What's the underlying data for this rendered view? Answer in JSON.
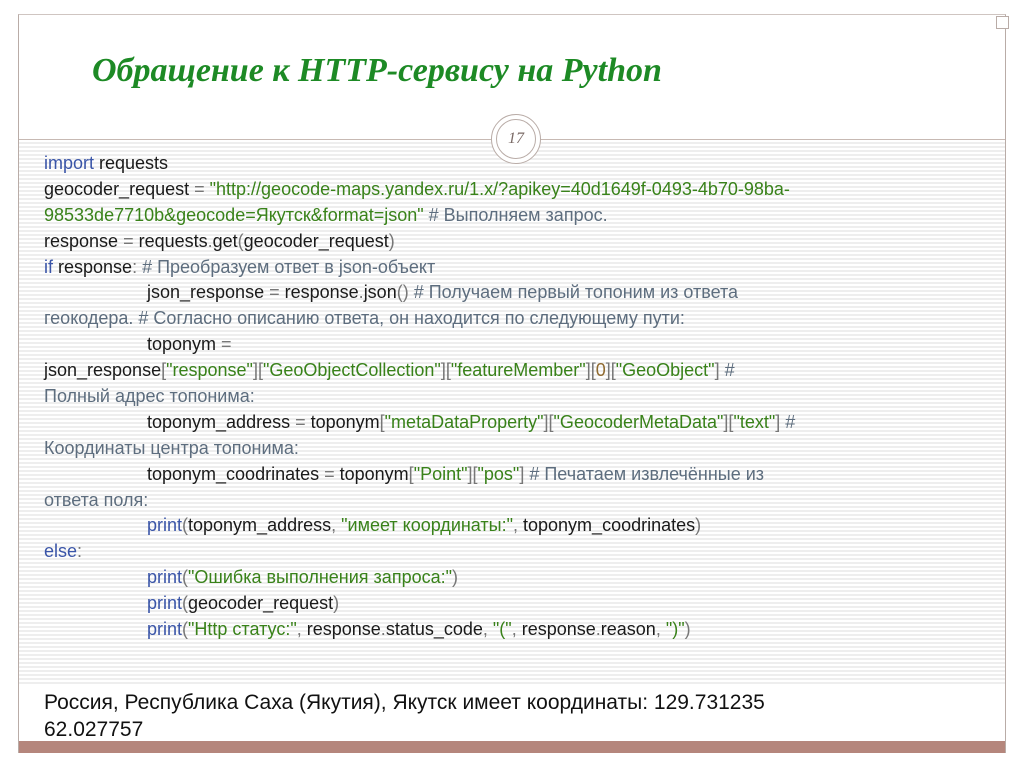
{
  "slide": {
    "title": "Обращение к HTTP-сервису на Python",
    "page_number": "17",
    "colors": {
      "title": "#1d8a25",
      "keyword": "#3a55a8",
      "string": "#39821a",
      "comment": "#5d6d7e",
      "bottom_band": "#b5867c"
    }
  },
  "code": {
    "l1": {
      "a": "import",
      "b": " requests"
    },
    "l2": {
      "a": "geocoder_request ",
      "b": "=",
      "c": " \"http://geocode-maps.yandex.ru/1.x/?apikey=40d1649f-0493-4b70-98ba-"
    },
    "l3": {
      "a": "98533de7710b&geocode=Якутск&format=json\"",
      "b": " # Выполняем запрос."
    },
    "l4": {
      "a": "response ",
      "b": "=",
      "c": " requests",
      "d": ".",
      "e": "get",
      "f": "(",
      "g": "geocoder_request",
      "h": ")"
    },
    "l5": {
      "a": "if",
      "b": " response",
      "c": ":",
      "d": " # Преобразуем ответ в json-объект"
    },
    "l6": {
      "a": "json_response ",
      "b": "=",
      "c": " response",
      "d": ".",
      "e": "json",
      "f": "()",
      "g": " # Получаем первый топоним из ответа"
    },
    "l7": {
      "a": "геокодера. # Согласно описанию ответа, он находится по следующему пути:"
    },
    "l8": {
      "a": "toponym ",
      "b": "="
    },
    "l9": {
      "a": "json_response",
      "b": "[",
      "c": "\"response\"",
      "d": "][",
      "e": "\"GeoObjectCollection\"",
      "f": "][",
      "g": "\"featureMember\"",
      "h": "][",
      "i": "0",
      "j": "][",
      "k": "\"GeoObject\"",
      "l": "]",
      "m": " #"
    },
    "l10": {
      "a": "Полный адрес топонима:"
    },
    "l11": {
      "a": "toponym_address ",
      "b": "=",
      "c": " toponym",
      "d": "[",
      "e": "\"metaDataProperty\"",
      "f": "][",
      "g": "\"GeocoderMetaData\"",
      "h": "][",
      "i": "\"text\"",
      "j": "]",
      "k": " #"
    },
    "l12": {
      "a": "Координаты центра топонима:"
    },
    "l13": {
      "a": "toponym_coodrinates ",
      "b": "=",
      "c": " toponym",
      "d": "[",
      "e": "\"Point\"",
      "f": "][",
      "g": "\"pos\"",
      "h": "]",
      "i": " # Печатаем извлечённые из"
    },
    "l14": {
      "a": "ответа поля:"
    },
    "l15": {
      "a": "print",
      "b": "(",
      "c": "toponym_address",
      "d": ", ",
      "e": "\"имеет координаты:\"",
      "f": ", ",
      "g": "toponym_coodrinates",
      "h": ")"
    },
    "l16": {
      "a": "else",
      "b": ":"
    },
    "l17": {
      "a": "print",
      "b": "(",
      "c": "\"Ошибка выполнения запроса:\"",
      "d": ")"
    },
    "l18": {
      "a": "print",
      "b": "(",
      "c": "geocoder_request",
      "d": ")"
    },
    "l19": {
      "a": "print",
      "b": "(",
      "c": "\"Http статус:\"",
      "d": ", ",
      "e": "response",
      "f": ".",
      "g": "status_code",
      "h": ", ",
      "i": "\"(\"",
      "j": ", ",
      "k": "response",
      "l": ".",
      "m": "reason",
      "n": ", ",
      "o": "\")\"",
      "p": ")"
    }
  },
  "output": {
    "line1": "Россия, Республика Саха (Якутия), Якутск имеет координаты: 129.731235",
    "line2": "62.027757"
  }
}
